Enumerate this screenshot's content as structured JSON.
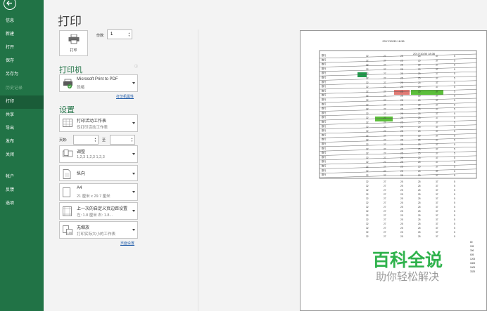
{
  "sidebar": {
    "items": [
      {
        "label": "信息",
        "state": "normal"
      },
      {
        "label": "新建",
        "state": "normal"
      },
      {
        "label": "打开",
        "state": "normal"
      },
      {
        "label": "保存",
        "state": "normal"
      },
      {
        "label": "另存为",
        "state": "normal"
      },
      {
        "label": "历史记录",
        "state": "disabled"
      },
      {
        "label": "打印",
        "state": "active"
      },
      {
        "label": "共享",
        "state": "normal"
      },
      {
        "label": "导出",
        "state": "normal"
      },
      {
        "label": "发布",
        "state": "normal"
      },
      {
        "label": "关闭",
        "state": "normal"
      },
      {
        "label": "帐户",
        "state": "normal"
      },
      {
        "label": "反馈",
        "state": "normal"
      },
      {
        "label": "选项",
        "state": "normal"
      }
    ]
  },
  "print": {
    "title": "打印",
    "button_label": "打印",
    "copies_label": "份数:",
    "copies_value": "1"
  },
  "printer": {
    "section_title": "打印机",
    "name": "Microsoft Print to PDF",
    "status": "就绪",
    "properties_link": "打印机属性"
  },
  "settings": {
    "section_title": "设置",
    "print_what_main": "打印活动工作表",
    "print_what_sub": "仅打印活动工作表",
    "pages_label": "页数:",
    "pages_to_label": "至",
    "collate_main": "调整",
    "collate_sub": "1,2,3    1,2,3    1,2,3",
    "orientation": "纵向",
    "paper_main": "A4",
    "paper_sub": "21 厘米 x 29.7 厘米",
    "margins_main": "上一次的自定义页边距设置",
    "margins_sub": "左: 1.8 厘米    右: 1.8...",
    "scaling_main": "无缩放",
    "scaling_sub": "打印实际大小的工作表",
    "page_setup_link": "页面设置"
  },
  "preview": {
    "header_text": "2017/10/30 18:36",
    "table_title_text": "2017/10/30 18:36",
    "row_label": "数行",
    "highlight_colors": {
      "green": "#5bbf3a",
      "dark_green": "#1f9a4b",
      "red": "#e07a74"
    },
    "column_values": [
      "32",
      "27",
      "25",
      "25",
      "37",
      "5"
    ],
    "tail_values": [
      "80",
      "155",
      "306",
      "605",
      "1205",
      "1805",
      "1605",
      "3325"
    ]
  },
  "watermark": {
    "title": "百科全说",
    "subtitle": "助你轻松解决"
  },
  "colors": {
    "sidebar_bg": "#217346",
    "sidebar_active_bg": "#1a5c38",
    "accent": "#217346",
    "link": "#1e5aa8"
  },
  "icons": [
    "back-arrow-icon",
    "printer-icon",
    "pdf-printer-icon",
    "sheet-icon",
    "collate-icon",
    "portrait-icon",
    "paper-icon",
    "margins-icon",
    "scaling-icon",
    "info-icon"
  ]
}
